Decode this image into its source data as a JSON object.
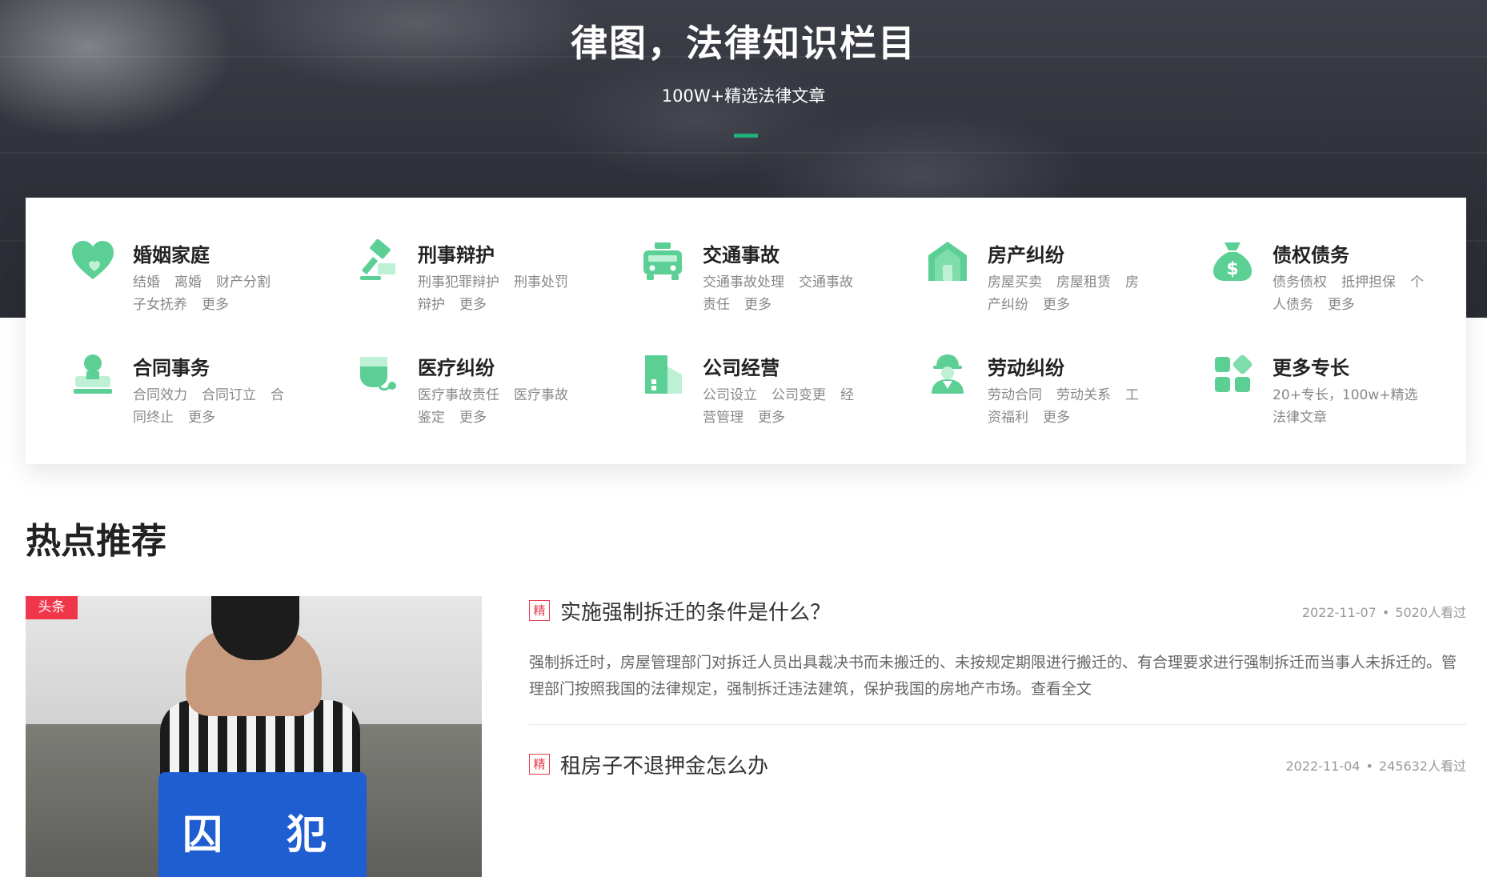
{
  "hero": {
    "title": "律图，法律知识栏目",
    "subtitle": "100W+精选法律文章"
  },
  "categories": [
    {
      "name": "婚姻家庭",
      "icon": "heart-icon",
      "links": [
        "结婚",
        "离婚",
        "财产分割",
        "子女抚养"
      ],
      "more": "更多"
    },
    {
      "name": "刑事辩护",
      "icon": "gavel-icon",
      "links": [
        "刑事犯罪辩护",
        "刑事处罚辩护"
      ],
      "more": "更多"
    },
    {
      "name": "交通事故",
      "icon": "car-icon",
      "links": [
        "交通事故处理",
        "交通事故责任"
      ],
      "more": "更多"
    },
    {
      "name": "房产纠纷",
      "icon": "house-icon",
      "links": [
        "房屋买卖",
        "房屋租赁",
        "房产纠纷"
      ],
      "more": "更多"
    },
    {
      "name": "债权债务",
      "icon": "money-bag-icon",
      "links": [
        "债务债权",
        "抵押担保",
        "个人债务"
      ],
      "more": "更多"
    },
    {
      "name": "合同事务",
      "icon": "person-stamp-icon",
      "links": [
        "合同效力",
        "合同订立",
        "合同终止"
      ],
      "more": "更多"
    },
    {
      "name": "医疗纠纷",
      "icon": "medical-bag-icon",
      "links": [
        "医疗事故责任",
        "医疗事故鉴定"
      ],
      "more": "更多"
    },
    {
      "name": "公司经营",
      "icon": "building-icon",
      "links": [
        "公司设立",
        "公司变更",
        "经营管理"
      ],
      "more": "更多"
    },
    {
      "name": "劳动纠纷",
      "icon": "worker-icon",
      "links": [
        "劳动合同",
        "劳动关系",
        "工资福利"
      ],
      "more": "更多"
    },
    {
      "name": "更多专长",
      "icon": "apps-grid-icon",
      "links": [
        "20+专长，100w+精选法律文章"
      ],
      "more": ""
    }
  ],
  "hot": {
    "section_title": "热点推荐",
    "feature_badge": "头条",
    "feature_image_text": [
      "囚",
      "犯"
    ],
    "articles": [
      {
        "tag": "精",
        "title": "实施强制拆迁的条件是什么？",
        "date": "2022-11-07",
        "views": "5020人看过",
        "desc": "强制拆迁时，房屋管理部门对拆迁人员出具裁决书而未搬迁的、未按规定期限进行搬迁的、有合理要求进行强制拆迁而当事人未拆迁的。管理部门按照我国的法律规定，强制拆迁违法建筑，保护我国的房地产市场。查看全文"
      },
      {
        "tag": "精",
        "title": "租房子不退押金怎么办",
        "date": "2022-11-04",
        "views": "245632人看过",
        "desc": ""
      }
    ]
  },
  "colors": {
    "accent_green": "#21b07a",
    "icon_green": "#5ccf95",
    "tag_red": "#e8394d",
    "badge_red": "#f0364a"
  }
}
